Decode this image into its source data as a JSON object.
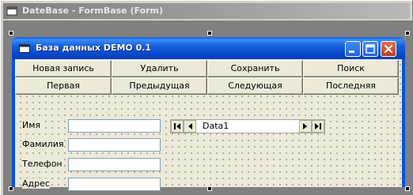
{
  "ide": {
    "title": "DateBase - FormBase (Form)"
  },
  "form": {
    "title": "База данных DEMO 0.1",
    "buttons_row1": [
      "Новая запись",
      "Удалить",
      "Сохранить",
      "Поиск"
    ],
    "buttons_row2": [
      "Первая",
      "Предыдущая",
      "Следующая",
      "Последняя"
    ],
    "labels": [
      "Имя",
      "Фамилия",
      "Телефон",
      "Адрес"
    ],
    "fields": [
      "",
      "",
      "",
      ""
    ],
    "data_control": {
      "caption": "Data1"
    }
  },
  "colors": {
    "xp_title_blue": "#0054e3",
    "form_body": "#ece9d8",
    "ide_gray": "#808080",
    "close_red": "#c3371a"
  },
  "icons": {
    "ide_title": "form-icon",
    "form_title": "form-icon",
    "minimize": "minimize-icon",
    "maximize": "maximize-icon",
    "close": "close-icon",
    "first": "first-record-icon",
    "prev": "previous-record-icon",
    "next": "next-record-icon",
    "last": "last-record-icon"
  }
}
